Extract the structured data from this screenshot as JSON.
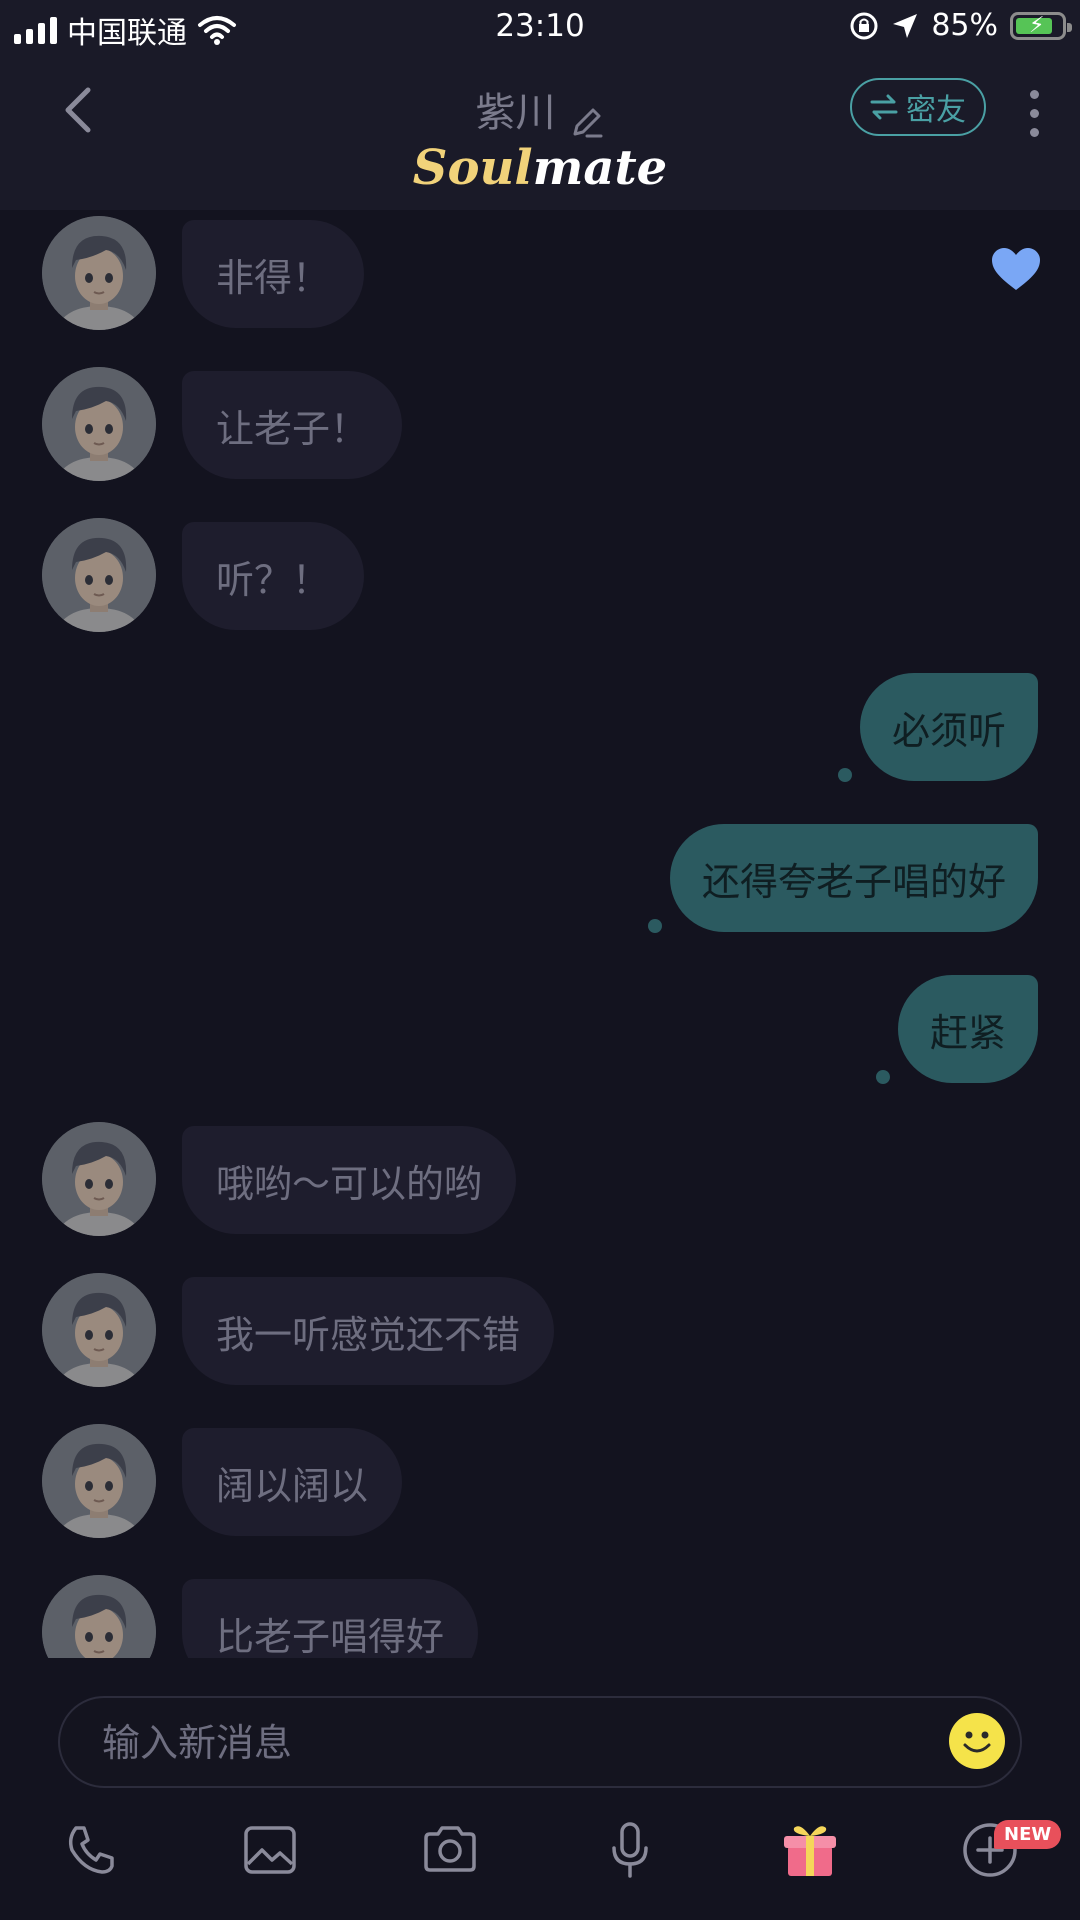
{
  "status": {
    "carrier": "中国联通",
    "time": "23:10",
    "battery": "85%"
  },
  "header": {
    "title": "紫川",
    "logo_part1": "Soul",
    "logo_part2": "mate",
    "mate_button": "密友"
  },
  "messages": [
    {
      "dir": "in",
      "text": "非得！"
    },
    {
      "dir": "in",
      "text": "让老子！"
    },
    {
      "dir": "in",
      "text": "听？！"
    },
    {
      "dir": "out",
      "text": "必须听"
    },
    {
      "dir": "out",
      "text": "还得夸老子唱的好"
    },
    {
      "dir": "out",
      "text": "赶紧"
    },
    {
      "dir": "in",
      "text": "哦哟～可以的哟"
    },
    {
      "dir": "in",
      "text": "我一听感觉还不错"
    },
    {
      "dir": "in",
      "text": "阔以阔以"
    },
    {
      "dir": "in",
      "text": "比老子唱得好"
    }
  ],
  "input": {
    "placeholder": "输入新消息"
  },
  "toolbar": {
    "new_badge": "NEW"
  },
  "colors": {
    "accent": "#4aa0a4",
    "outgoing_bubble": "#2b5a60",
    "heart": "#7aa7f5"
  }
}
